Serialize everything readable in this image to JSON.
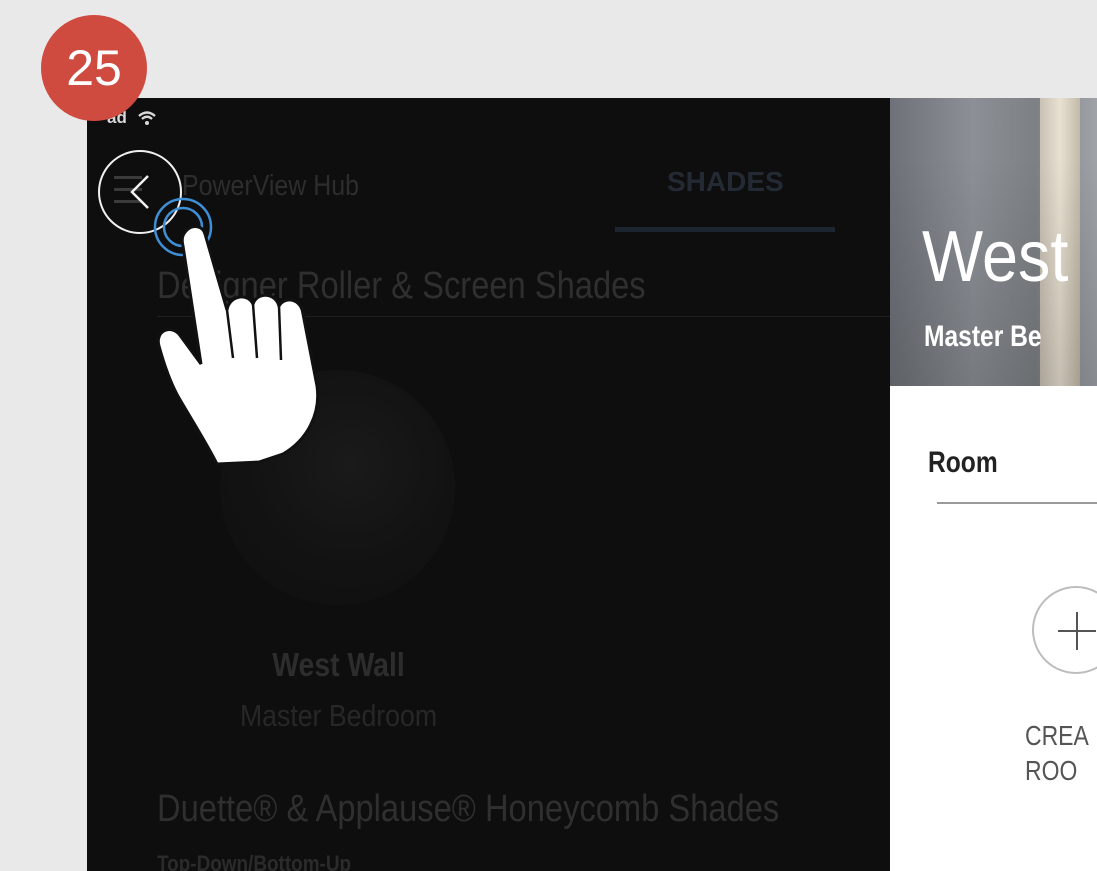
{
  "step_badge": "25",
  "status_bar": {
    "carrier": "ad",
    "wifi_icon": "wifi-icon"
  },
  "app": {
    "title": "PowerView Hub",
    "tab": "SHADES",
    "sections": [
      {
        "heading": "Designer Roller & Screen Shades",
        "shades": [
          {
            "name": "West Wall",
            "room": "Master Bedroom"
          }
        ]
      },
      {
        "heading": "Duette® & Applause® Honeycomb Shades",
        "subheading": "Top-Down/Bottom-Up"
      }
    ]
  },
  "detail_panel": {
    "title": "West",
    "subtitle": "Master Be",
    "room_label": "Room",
    "create_label": "CREA\nROO"
  },
  "colors": {
    "badge": "#cf4a3f",
    "overlay": "#0e0e0e",
    "panel_bg": "#ffffff"
  }
}
